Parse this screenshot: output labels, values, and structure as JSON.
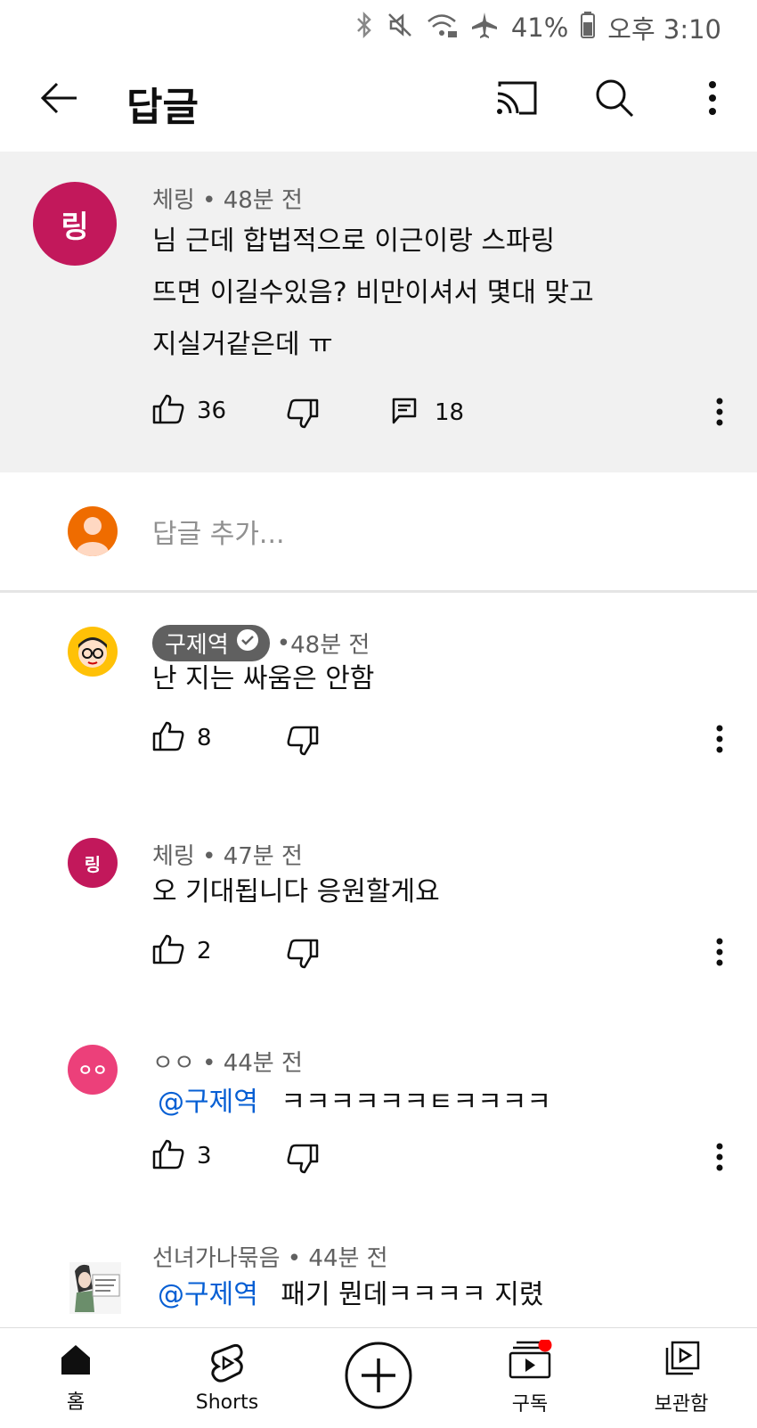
{
  "status_bar": {
    "battery": "41%",
    "time": "오후 3:10"
  },
  "app_bar": {
    "title": "답글"
  },
  "main_comment": {
    "avatar_letter": "링",
    "avatar_color": "#c2185b",
    "author": "체링",
    "time": "48분 전",
    "lines": [
      "님 근데 합법적으로 이근이랑 스파링",
      "뜨면 이길수있음? 비만이셔서 몇대 맞고",
      "지실거같은데 ㅠ"
    ],
    "likes": "36",
    "replies": "18"
  },
  "add_reply": {
    "placeholder": "답글 추가..."
  },
  "replies": [
    {
      "author": "구제역",
      "verified": true,
      "time": "48분 전",
      "text": "난 지는 싸움은 안함",
      "likes": "8"
    },
    {
      "author": "체링",
      "avatar_letter": "링",
      "time": "47분 전",
      "text": "오 기대됩니다 응원할게요",
      "likes": "2"
    },
    {
      "author": "ㅇㅇ",
      "avatar_letter": "ㅇㅇ",
      "time": "44분 전",
      "mention": "@구제역",
      "text": "ㅋㅋㅋㅋㅋㅋㅌㅋㅋㅋㅋ",
      "likes": "3"
    },
    {
      "author": "선녀가나묶음",
      "time": "44분 전",
      "mention": "@구제역",
      "text": "패기 뭔데ㅋㅋㅋㅋ 지렸"
    }
  ],
  "bottom_nav": [
    {
      "label": "홈",
      "icon": "home-icon"
    },
    {
      "label": "Shorts",
      "icon": "shorts-icon"
    },
    {
      "label": "",
      "icon": "create-icon"
    },
    {
      "label": "구독",
      "icon": "subscriptions-icon"
    },
    {
      "label": "보관함",
      "icon": "library-icon"
    }
  ],
  "colors": {
    "accent_red": "#ff0000",
    "mention_blue": "#065fd4",
    "pink_avatar": "#ec407a",
    "orange_avatar": "#ef6c00"
  }
}
